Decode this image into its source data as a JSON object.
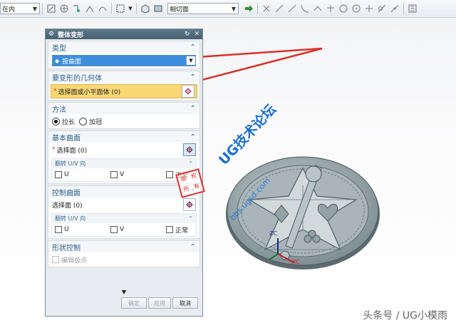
{
  "toolbar": {
    "filter_value": "在内",
    "snap_value": "相切面",
    "icons": [
      "dropdown-arrow-icon",
      "select-filter-icon",
      "snap-point-icon",
      "snap-options-icon",
      "box-select-icon",
      "view-cube-icon",
      "render-icon",
      "arrow-right-icon",
      "cross-icon",
      "line-icon",
      "curve-icon",
      "angle-icon",
      "circle-icon",
      "plus-icon",
      "tangent-icon",
      "point-icon",
      "layer-icon"
    ]
  },
  "dialog": {
    "title": "整体变形",
    "type_section": {
      "header": "类型",
      "value": "按曲面"
    },
    "geometry_section": {
      "header": "要变形的几何体",
      "select_label": "选择面或小平面体 (0)"
    },
    "method_section": {
      "header": "方法",
      "options": [
        "拉长",
        "加冠"
      ],
      "selected": "拉长"
    },
    "base_surface_section": {
      "header": "基本曲面",
      "select_label": "选择面 (0)",
      "flip_header": "翻转 U/V 向",
      "checks": [
        "U",
        "V",
        "正常"
      ]
    },
    "control_surface_section": {
      "header": "控制曲面",
      "select_label": "选择面 (0)",
      "flip_header": "翻转 U/V 向",
      "checks": [
        "U",
        "V",
        "正常"
      ]
    },
    "shape_control_section": {
      "header": "形状控制",
      "edit_poles_label": "编辑极点"
    },
    "buttons": {
      "ok": "确定",
      "apply": "应用",
      "cancel": "取消"
    }
  },
  "watermark": {
    "title": "UG技术论坛",
    "url": "bbs.ugsd.com",
    "stamp": [
      "版",
      "权",
      "所",
      "有"
    ]
  },
  "axes": {
    "zc": "ZC",
    "xc": "XC"
  },
  "credit": "头条号 / UG小模雨",
  "colors": {
    "accent_blue": "#3e8ede",
    "header_blue": "#2c5e86",
    "highlight_yellow": "#f9d774",
    "arrow_red": "#d9312b"
  }
}
